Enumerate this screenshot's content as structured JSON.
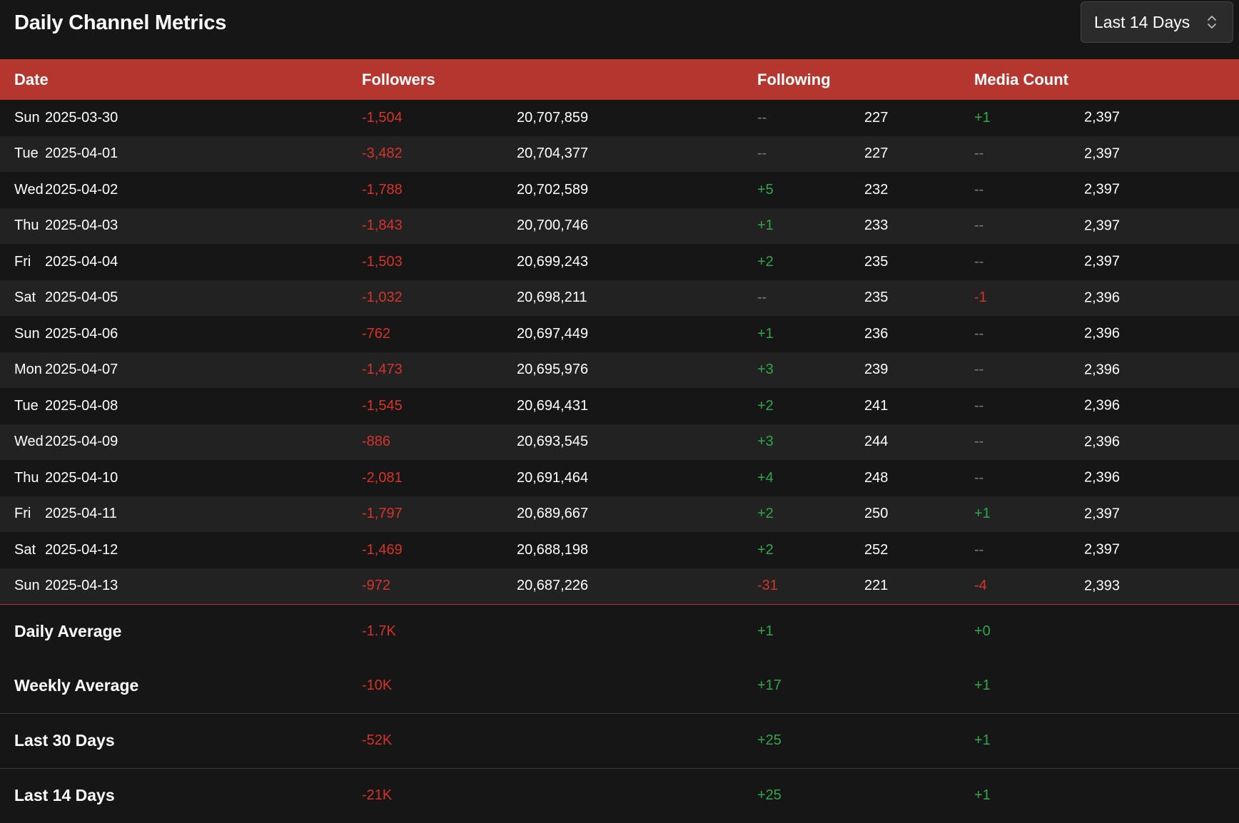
{
  "header": {
    "title": "Daily Channel Metrics",
    "range_select": {
      "value": "Last 14 Days",
      "icon": "chevron-up-down-icon"
    }
  },
  "table": {
    "columns": {
      "date": "Date",
      "followers": "Followers",
      "following": "Following",
      "media": "Media Count"
    },
    "rows": [
      {
        "day": "Sun",
        "date": "2025-03-30",
        "followers_change": "-1,504",
        "followers_change_sign": "neg",
        "followers_total": "20,707,859",
        "following_change": "--",
        "following_change_sign": "zero",
        "following_total": "227",
        "media_change": "+1",
        "media_change_sign": "pos",
        "media_total": "2,397"
      },
      {
        "day": "Tue",
        "date": "2025-04-01",
        "followers_change": "-3,482",
        "followers_change_sign": "neg",
        "followers_total": "20,704,377",
        "following_change": "--",
        "following_change_sign": "zero",
        "following_total": "227",
        "media_change": "--",
        "media_change_sign": "zero",
        "media_total": "2,397"
      },
      {
        "day": "Wed",
        "date": "2025-04-02",
        "followers_change": "-1,788",
        "followers_change_sign": "neg",
        "followers_total": "20,702,589",
        "following_change": "+5",
        "following_change_sign": "pos",
        "following_total": "232",
        "media_change": "--",
        "media_change_sign": "zero",
        "media_total": "2,397"
      },
      {
        "day": "Thu",
        "date": "2025-04-03",
        "followers_change": "-1,843",
        "followers_change_sign": "neg",
        "followers_total": "20,700,746",
        "following_change": "+1",
        "following_change_sign": "pos",
        "following_total": "233",
        "media_change": "--",
        "media_change_sign": "zero",
        "media_total": "2,397"
      },
      {
        "day": "Fri",
        "date": "2025-04-04",
        "followers_change": "-1,503",
        "followers_change_sign": "neg",
        "followers_total": "20,699,243",
        "following_change": "+2",
        "following_change_sign": "pos",
        "following_total": "235",
        "media_change": "--",
        "media_change_sign": "zero",
        "media_total": "2,397"
      },
      {
        "day": "Sat",
        "date": "2025-04-05",
        "followers_change": "-1,032",
        "followers_change_sign": "neg",
        "followers_total": "20,698,211",
        "following_change": "--",
        "following_change_sign": "zero",
        "following_total": "235",
        "media_change": "-1",
        "media_change_sign": "neg",
        "media_total": "2,396"
      },
      {
        "day": "Sun",
        "date": "2025-04-06",
        "followers_change": "-762",
        "followers_change_sign": "neg",
        "followers_total": "20,697,449",
        "following_change": "+1",
        "following_change_sign": "pos",
        "following_total": "236",
        "media_change": "--",
        "media_change_sign": "zero",
        "media_total": "2,396"
      },
      {
        "day": "Mon",
        "date": "2025-04-07",
        "followers_change": "-1,473",
        "followers_change_sign": "neg",
        "followers_total": "20,695,976",
        "following_change": "+3",
        "following_change_sign": "pos",
        "following_total": "239",
        "media_change": "--",
        "media_change_sign": "zero",
        "media_total": "2,396"
      },
      {
        "day": "Tue",
        "date": "2025-04-08",
        "followers_change": "-1,545",
        "followers_change_sign": "neg",
        "followers_total": "20,694,431",
        "following_change": "+2",
        "following_change_sign": "pos",
        "following_total": "241",
        "media_change": "--",
        "media_change_sign": "zero",
        "media_total": "2,396"
      },
      {
        "day": "Wed",
        "date": "2025-04-09",
        "followers_change": "-886",
        "followers_change_sign": "neg",
        "followers_total": "20,693,545",
        "following_change": "+3",
        "following_change_sign": "pos",
        "following_total": "244",
        "media_change": "--",
        "media_change_sign": "zero",
        "media_total": "2,396"
      },
      {
        "day": "Thu",
        "date": "2025-04-10",
        "followers_change": "-2,081",
        "followers_change_sign": "neg",
        "followers_total": "20,691,464",
        "following_change": "+4",
        "following_change_sign": "pos",
        "following_total": "248",
        "media_change": "--",
        "media_change_sign": "zero",
        "media_total": "2,396"
      },
      {
        "day": "Fri",
        "date": "2025-04-11",
        "followers_change": "-1,797",
        "followers_change_sign": "neg",
        "followers_total": "20,689,667",
        "following_change": "+2",
        "following_change_sign": "pos",
        "following_total": "250",
        "media_change": "+1",
        "media_change_sign": "pos",
        "media_total": "2,397"
      },
      {
        "day": "Sat",
        "date": "2025-04-12",
        "followers_change": "-1,469",
        "followers_change_sign": "neg",
        "followers_total": "20,688,198",
        "following_change": "+2",
        "following_change_sign": "pos",
        "following_total": "252",
        "media_change": "--",
        "media_change_sign": "zero",
        "media_total": "2,397"
      },
      {
        "day": "Sun",
        "date": "2025-04-13",
        "followers_change": "-972",
        "followers_change_sign": "neg",
        "followers_total": "20,687,226",
        "following_change": "-31",
        "following_change_sign": "neg",
        "following_total": "221",
        "media_change": "-4",
        "media_change_sign": "neg",
        "media_total": "2,393"
      }
    ],
    "summary": [
      {
        "label": "Daily Average",
        "followers": "-1.7K",
        "followers_sign": "neg",
        "following": "+1",
        "following_sign": "pos",
        "media": "+0",
        "media_sign": "pos"
      },
      {
        "label": "Weekly Average",
        "followers": "-10K",
        "followers_sign": "neg",
        "following": "+17",
        "following_sign": "pos",
        "media": "+1",
        "media_sign": "pos"
      },
      {
        "label": "Last 30 Days",
        "followers": "-52K",
        "followers_sign": "neg",
        "following": "+25",
        "following_sign": "pos",
        "media": "+1",
        "media_sign": "pos"
      },
      {
        "label": "Last 14 Days",
        "followers": "-21K",
        "followers_sign": "neg",
        "following": "+25",
        "following_sign": "pos",
        "media": "+1",
        "media_sign": "pos"
      }
    ]
  },
  "colors": {
    "header_bg": "#b5362e",
    "negative": "#d6332c",
    "positive": "#2ea84a",
    "neutral": "#7a7a7a"
  }
}
